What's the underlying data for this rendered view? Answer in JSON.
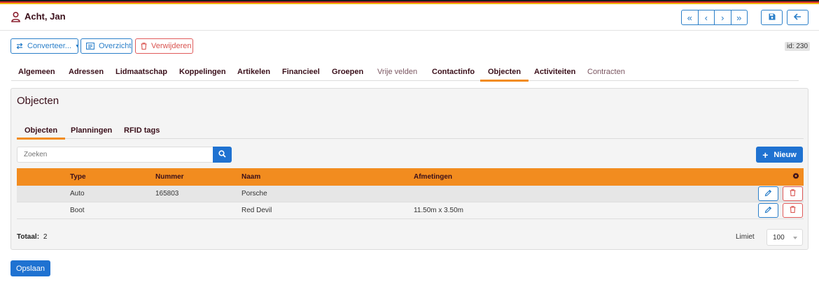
{
  "header": {
    "title": "Acht, Jan",
    "pager_icons": [
      "first-page-icon",
      "previous-page-icon",
      "next-page-icon",
      "last-page-icon"
    ],
    "pager_glyphs": [
      "«",
      "‹",
      "›",
      "»"
    ]
  },
  "toolbar": {
    "convert_label": "Converteer...",
    "overview_label": "Overzicht",
    "delete_label": "Verwijderen",
    "id_badge": "id: 230"
  },
  "tabs": [
    {
      "label": "Algemeen"
    },
    {
      "label": "Adressen"
    },
    {
      "label": "Lidmaatschap"
    },
    {
      "label": "Koppelingen"
    },
    {
      "label": "Artikelen"
    },
    {
      "label": "Financieel"
    },
    {
      "label": "Groepen"
    },
    {
      "label": "Vrije velden"
    },
    {
      "label": "Contactinfo"
    },
    {
      "label": "Objecten"
    },
    {
      "label": "Activiteiten"
    },
    {
      "label": "Contracten"
    }
  ],
  "panel": {
    "title": "Objecten",
    "subtabs": [
      {
        "label": "Objecten"
      },
      {
        "label": "Planningen"
      },
      {
        "label": "RFID tags"
      }
    ],
    "search": {
      "placeholder": "Zoeken",
      "value": ""
    },
    "new_label": "Nieuw",
    "table": {
      "columns": [
        "Type",
        "Nummer",
        "Naam",
        "Afmetingen"
      ],
      "rows": [
        {
          "type": "Auto",
          "nummer": "165803",
          "naam": "Porsche",
          "afmetingen": ""
        },
        {
          "type": "Boot",
          "nummer": "",
          "naam": "Red Devil",
          "afmetingen": "11.50m x 3.50m"
        }
      ]
    },
    "footer": {
      "total_label": "Totaal:",
      "total_value": "2",
      "limit_label": "Limiet",
      "limit_value": "100"
    }
  },
  "save_label": "Opslaan",
  "colors": {
    "accent": "#f28c1f",
    "primary": "#1f72d1",
    "danger": "#d9534f",
    "text_dark": "#3a0f1a"
  }
}
